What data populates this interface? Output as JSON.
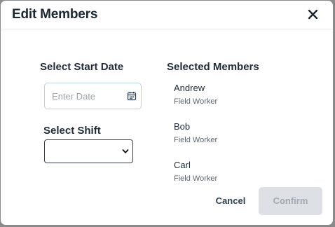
{
  "dialog": {
    "title": "Edit Members",
    "close_icon": "close-x-icon"
  },
  "form": {
    "start_date": {
      "label": "Select Start Date",
      "placeholder": "Enter Date",
      "value": "",
      "icon": "calendar-icon"
    },
    "shift": {
      "label": "Select Shift",
      "value": "",
      "icon": "chevron-down-icon"
    }
  },
  "members": {
    "heading": "Selected Members",
    "items": [
      {
        "name": "Andrew",
        "role": "Field Worker"
      },
      {
        "name": "Bob",
        "role": "Field Worker"
      },
      {
        "name": "Carl",
        "role": "Field Worker"
      }
    ]
  },
  "actions": {
    "cancel_label": "Cancel",
    "confirm_label": "Confirm",
    "confirm_disabled": true
  },
  "colors": {
    "title_text": "#1b2633",
    "date_border": "#bcd3d8",
    "confirm_bg_disabled": "#dde1e5",
    "confirm_text_disabled": "#a0a8b0",
    "cancel_text": "#2d3e52"
  }
}
